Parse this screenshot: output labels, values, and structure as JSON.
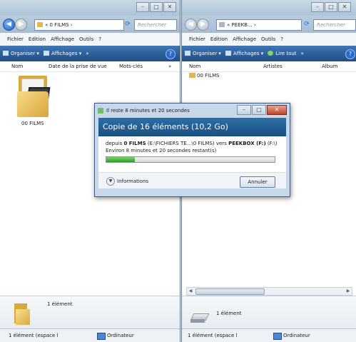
{
  "left_window": {
    "address": "« 0 FILMS ›",
    "search_placeholder": "Rechercher",
    "menu": [
      "Fichier",
      "Edition",
      "Affichage",
      "Outils",
      "?"
    ],
    "commands": [
      "Organiser ▾",
      "Affichages ▾",
      "»"
    ],
    "columns": [
      "Nom",
      "Date de la prise de vue",
      "Mots-clés",
      "»"
    ],
    "folder_name": "00 FILMS",
    "details_count": "1 élément",
    "status_left": "1 élément (espace l",
    "status_right": "Ordinateur"
  },
  "right_window": {
    "address": "« PEEKB... ›",
    "search_placeholder": "Rechercher",
    "menu": [
      "Fichier",
      "Edition",
      "Affichage",
      "Outils",
      "?"
    ],
    "commands": [
      "Organiser ▾",
      "Affichages ▾",
      "Lire tout",
      "»"
    ],
    "columns": [
      "Nom",
      "Artistes",
      "Album"
    ],
    "folder_name": "00 FILMS",
    "details_count": "1 élément",
    "status_left": "1 élément (espace l",
    "status_right": "Ordinateur"
  },
  "dialog": {
    "title": "Il reste 8 minutes et 20 secondes",
    "heading": "Copie de 16 éléments (10,2 Go)",
    "from_label": "depuis",
    "from_bold": "0 FILMS",
    "from_path": "(E:\\FICHIERS TE...\\0 FILMS)",
    "to_label": "vers",
    "to_bold": "PEEKBOX (F:)",
    "to_path": "(F:\\)",
    "remaining": "Environ 8 minutes et 20 secondes restant(s)",
    "progress": 0.17,
    "info_label": "Informations",
    "cancel_label": "Annuler"
  },
  "colors": {
    "command_bar": "#2f5f99",
    "dialog_header": "#245f93",
    "progress_fill": "#3aa834"
  }
}
